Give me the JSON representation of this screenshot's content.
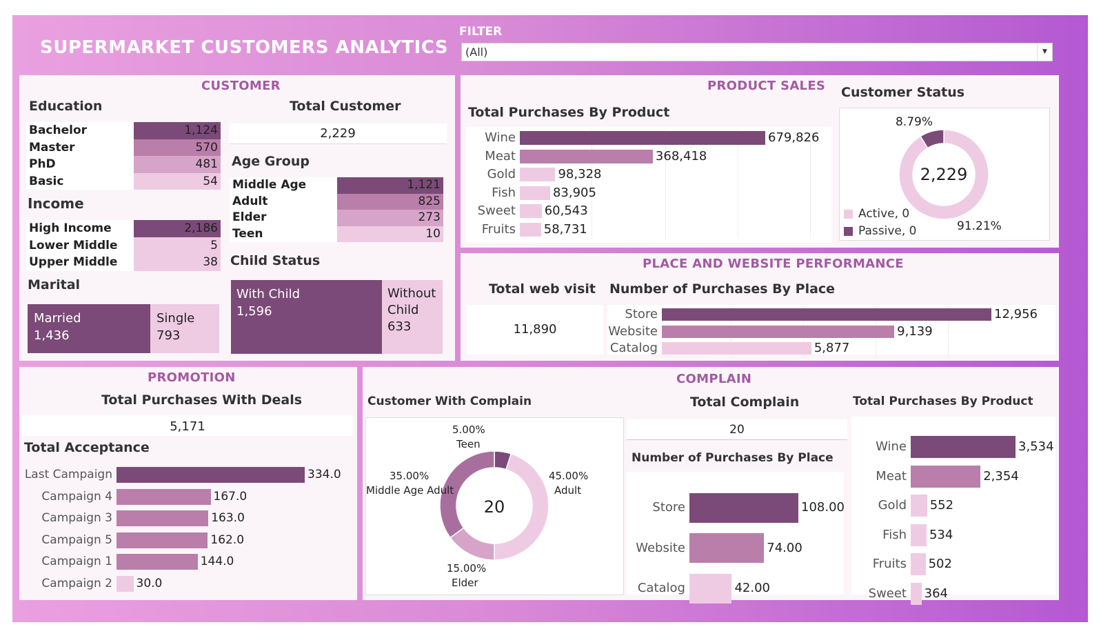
{
  "title": "SUPERMARKET CUSTOMERS ANALYTICS",
  "filter": {
    "label": "FILTER",
    "value": "(All)"
  },
  "customer": {
    "section": "CUSTOMER",
    "education": {
      "title": "Education",
      "rows": [
        {
          "label": "Bachelor",
          "value": "1,124",
          "n": 1124
        },
        {
          "label": "Master",
          "value": "570",
          "n": 570
        },
        {
          "label": "PhD",
          "value": "481",
          "n": 481
        },
        {
          "label": "Basic",
          "value": "54",
          "n": 54
        }
      ]
    },
    "income": {
      "title": "Income",
      "rows": [
        {
          "label": "High Income",
          "value": "2,186",
          "n": 2186
        },
        {
          "label": "Lower Middle",
          "value": "5",
          "n": 5
        },
        {
          "label": "Upper Middle",
          "value": "38",
          "n": 38
        }
      ]
    },
    "marital": {
      "title": "Marital",
      "married_label": "Married",
      "married_value": "1,436",
      "single_label": "Single",
      "single_value": "793"
    },
    "total_customer": {
      "title": "Total Customer",
      "value": "2,229"
    },
    "age_group": {
      "title": "Age Group",
      "rows": [
        {
          "label": "Middle Age Adult",
          "value": "1,121",
          "n": 1121
        },
        {
          "label": "Adult",
          "value": "825",
          "n": 825
        },
        {
          "label": "Elder",
          "value": "273",
          "n": 273
        },
        {
          "label": "Teen",
          "value": "10",
          "n": 10
        }
      ]
    },
    "child_status": {
      "title": "Child Status",
      "with_label": "With Child",
      "with_value": "1,596",
      "without_line1": "Without",
      "without_line2": "Child",
      "without_value": "633"
    }
  },
  "product_sales": {
    "section": "PRODUCT SALES",
    "chart_title": "Total Purchases By Product",
    "status_title": "Customer Status",
    "donut_center": "2,229",
    "pct_small": "8.79%",
    "pct_large": "91.21%",
    "legend": [
      {
        "label": "Active, 0"
      },
      {
        "label": "Passive, 0"
      }
    ]
  },
  "place_web": {
    "section": "PLACE AND WEBSITE PERFORMANCE",
    "web_title": "Total web visit",
    "web_value": "11,890",
    "chart_title": "Number of Purchases By Place"
  },
  "promotion": {
    "section": "PROMOTION",
    "deals_title": "Total Purchases With Deals",
    "deals_value": "5,171",
    "acceptance_title": "Total Acceptance"
  },
  "complain": {
    "section": "COMPLAIN",
    "customer_title": "Customer With Complain",
    "donut_center": "20",
    "slices": [
      {
        "label": "Teen",
        "pct": "5.00%"
      },
      {
        "label": "Adult",
        "pct": "45.00%"
      },
      {
        "label": "Elder",
        "pct": "15.00%"
      },
      {
        "label": "Middle Age Adult",
        "pct": "35.00%"
      }
    ],
    "total_title": "Total Complain",
    "total_value": "20",
    "place_title": "Number of Purchases By Place",
    "product_title": "Total Purchases By Product"
  },
  "colors": {
    "dark": "#7b4a78",
    "mid": "#b97ea9",
    "light": "#d6a4c8",
    "pale": "#eecbe3",
    "accent": "#a35aa2"
  },
  "chart_data": [
    {
      "type": "bar",
      "orientation": "horizontal",
      "title": "Total Purchases By Product",
      "categories": [
        "Wine",
        "Meat",
        "Gold",
        "Fish",
        "Sweet",
        "Fruits"
      ],
      "values": [
        679826,
        368418,
        98328,
        83905,
        60543,
        58731
      ],
      "labels": [
        "679,826",
        "368,418",
        "98,328",
        "83,905",
        "60,543",
        "58,731"
      ]
    },
    {
      "type": "pie",
      "title": "Customer Status",
      "center": "2,229",
      "slices": [
        {
          "name": "Active",
          "value": 8.79
        },
        {
          "name": "Passive",
          "value": 91.21
        }
      ]
    },
    {
      "type": "bar",
      "orientation": "horizontal",
      "title": "Number of Purchases By Place",
      "categories": [
        "Store",
        "Website",
        "Catalog"
      ],
      "values": [
        12956,
        9139,
        5877
      ],
      "labels": [
        "12,956",
        "9,139",
        "5,877"
      ]
    },
    {
      "type": "bar",
      "orientation": "horizontal",
      "title": "Total Acceptance",
      "categories": [
        "Last Campaign",
        "Campaign 4",
        "Campaign 3",
        "Campaign 5",
        "Campaign 1",
        "Campaign 2"
      ],
      "values": [
        334,
        167,
        163,
        162,
        144,
        30
      ],
      "labels": [
        "334.0",
        "167.0",
        "163.0",
        "162.0",
        "144.0",
        "30.0"
      ]
    },
    {
      "type": "pie",
      "title": "Customer With Complain",
      "center": "20",
      "slices": [
        {
          "name": "Teen",
          "value": 5
        },
        {
          "name": "Adult",
          "value": 45
        },
        {
          "name": "Elder",
          "value": 15
        },
        {
          "name": "Middle Age Adult",
          "value": 35
        }
      ]
    },
    {
      "type": "bar",
      "orientation": "horizontal",
      "title": "Number of Purchases By Place",
      "categories": [
        "Store",
        "Website",
        "Catalog"
      ],
      "values": [
        108,
        74,
        42
      ],
      "labels": [
        "108.00",
        "74.00",
        "42.00"
      ]
    },
    {
      "type": "bar",
      "orientation": "horizontal",
      "title": "Total Purchases By Product",
      "categories": [
        "Wine",
        "Meat",
        "Gold",
        "Fish",
        "Fruits",
        "Sweet"
      ],
      "values": [
        3534,
        2354,
        552,
        534,
        502,
        364
      ],
      "labels": [
        "3,534",
        "2,354",
        "552",
        "534",
        "502",
        "364"
      ]
    }
  ]
}
